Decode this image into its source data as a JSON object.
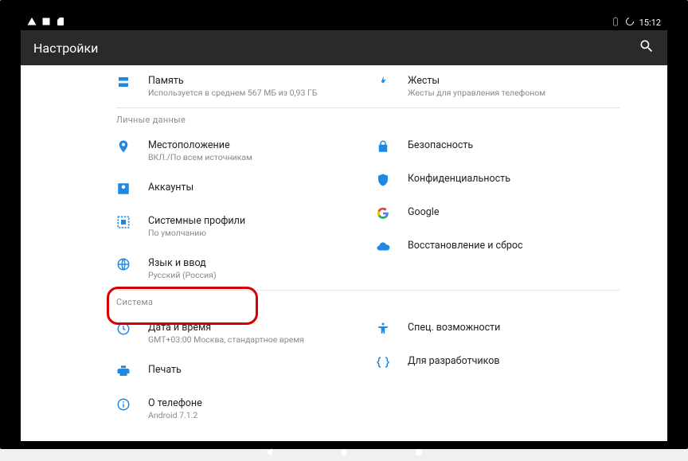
{
  "statusbar": {
    "time": "15:12"
  },
  "appbar": {
    "title": "Настройки"
  },
  "sections": {
    "top": {
      "left": {
        "storage": {
          "title": "Память",
          "sub": "Используется в среднем 567 МБ из 0,93 ГБ"
        }
      },
      "right": {
        "gestures": {
          "title": "Жесты",
          "sub": "Жесты для управления телефоном"
        }
      }
    },
    "personal": {
      "header": "Личные данные",
      "left": {
        "location": {
          "title": "Местоположение",
          "sub": "ВКЛ./По всем источникам"
        },
        "accounts": {
          "title": "Аккаунты"
        },
        "profiles": {
          "title": "Системные профили",
          "sub": "По умолчанию"
        },
        "lang": {
          "title": "Язык и ввод",
          "sub": "Русский (Россия)"
        }
      },
      "right": {
        "security": {
          "title": "Безопасность"
        },
        "privacy": {
          "title": "Конфиденциальность"
        },
        "google": {
          "title": "Google"
        },
        "backup": {
          "title": "Восстановление и сброс"
        }
      }
    },
    "system": {
      "header": "Система",
      "left": {
        "datetime": {
          "title": "Дата и время",
          "sub": "GMT+03:00 Москва, стандартное время"
        },
        "print": {
          "title": "Печать"
        },
        "about": {
          "title": "О телефоне",
          "sub": "Android 7.1.2"
        }
      },
      "right": {
        "access": {
          "title": "Спец. возможности"
        },
        "dev": {
          "title": "Для разработчиков"
        }
      }
    }
  }
}
